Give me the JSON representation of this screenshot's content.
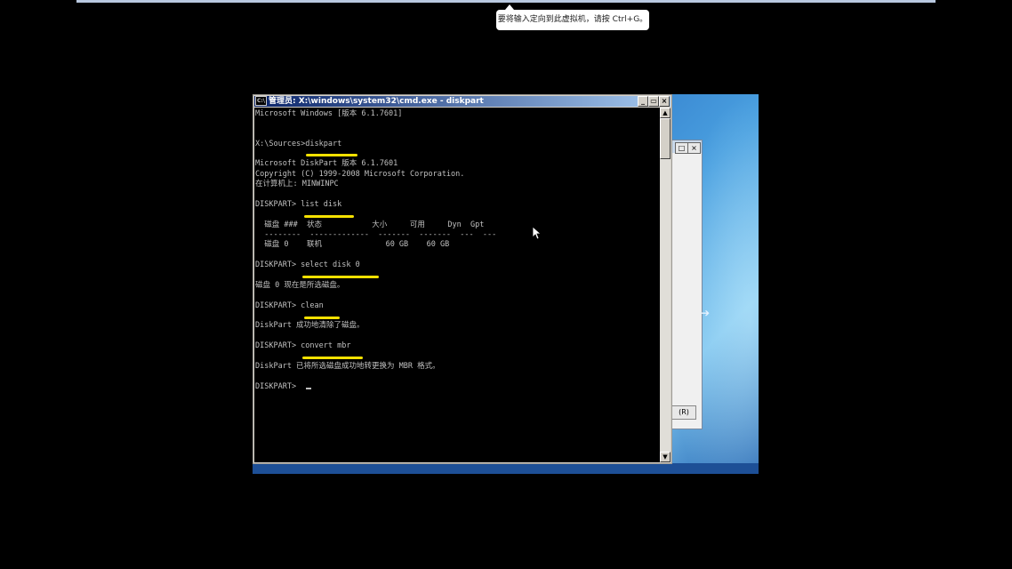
{
  "tooltip": "要将输入定向到此虚拟机，请按 Ctrl+G。",
  "cmd_window": {
    "title": "管理员: X:\\windows\\system32\\cmd.exe - diskpart",
    "icon": "C:\\",
    "min_label": "_",
    "max_label": "▭",
    "close_label": "×"
  },
  "setup_window": {
    "min_label": "□",
    "close_label": "×",
    "button_label": "(R)"
  },
  "console_lines": [
    "Microsoft Windows [版本 6.1.7601]",
    "",
    "",
    "X:\\Sources>diskpart",
    "",
    "Microsoft DiskPart 版本 6.1.7601",
    "Copyright (C) 1999-2008 Microsoft Corporation.",
    "在计算机上: MINWINPC",
    "",
    "DISKPART> list disk",
    "",
    "  磁盘 ###  状态           大小     可用     Dyn  Gpt",
    "  --------  -------------  -------  -------  ---  ---",
    "  磁盘 0    联机              60 GB    60 GB",
    "",
    "DISKPART> select disk 0",
    "",
    "磁盘 0 现在是所选磁盘。",
    "",
    "DISKPART> clean",
    "",
    "DiskPart 成功地清除了磁盘。",
    "",
    "DISKPART> convert mbr",
    "",
    "DiskPart 已将所选磁盘成功地转更换为 MBR 格式。",
    "",
    "DISKPART> "
  ],
  "colors": {
    "highlight": "#f5e100",
    "console_bg": "#000000",
    "console_fg": "#c0c0c0"
  }
}
